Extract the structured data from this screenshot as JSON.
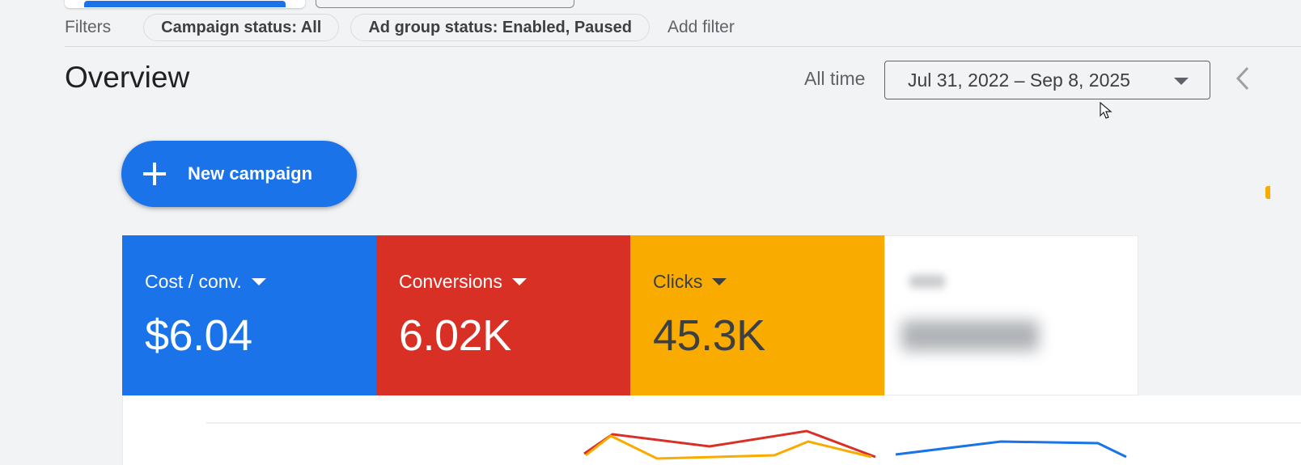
{
  "filters": {
    "label": "Filters",
    "chips": [
      "Campaign status: All",
      "Ad group status: Enabled, Paused"
    ],
    "add_filter": "Add filter"
  },
  "overview": {
    "title": "Overview",
    "range_label": "All time",
    "date_range": "Jul 31, 2022 – Sep 8, 2025"
  },
  "new_campaign": {
    "label": "New campaign"
  },
  "metrics": [
    {
      "label": "Cost / conv.",
      "value": "$6.04",
      "color": "#1a73e8"
    },
    {
      "label": "Conversions",
      "value": "6.02K",
      "color": "#d93025"
    },
    {
      "label": "Clicks",
      "value": "45.3K",
      "color": "#f9ab00"
    }
  ],
  "chart": {
    "series_colors": [
      "#1a73e8",
      "#d93025",
      "#f9ab00"
    ]
  },
  "icons": [
    "plus-icon",
    "chevron-left-icon",
    "dropdown-caret-icon",
    "mouse-cursor-icon"
  ]
}
